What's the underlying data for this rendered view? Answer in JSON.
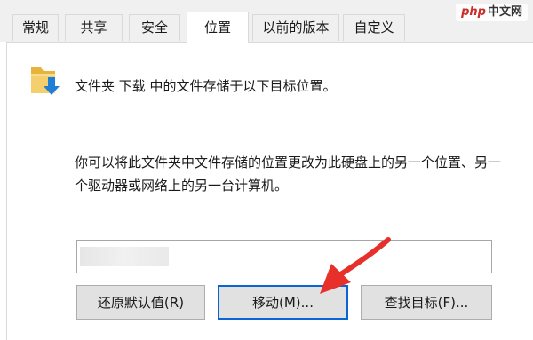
{
  "tabs": [
    {
      "label": "常规",
      "active": false
    },
    {
      "label": "共享",
      "active": false
    },
    {
      "label": "安全",
      "active": false
    },
    {
      "label": "位置",
      "active": true
    },
    {
      "label": "以前的版本",
      "active": false
    },
    {
      "label": "自定义",
      "active": false
    }
  ],
  "location": {
    "folder_icon": "folder-download-icon",
    "text": "文件夹 下载 中的文件存储于以下目标位置。"
  },
  "description": "你可以将此文件夹中文件存储的位置更改为此硬盘上的另一个位置、另一个驱动器或网络上的另一台计算机。",
  "path_input": {
    "value": ""
  },
  "buttons": {
    "restore": "还原默认值(R)",
    "move": "移动(M)...",
    "find_target": "查找目标(F)..."
  },
  "watermark": {
    "prefix": "php",
    "suffix": "中文网"
  },
  "colors": {
    "focus": "#0a64d6",
    "arrow": "#e8302a",
    "folder": "#f0c14b",
    "download": "#1f7fd6"
  }
}
